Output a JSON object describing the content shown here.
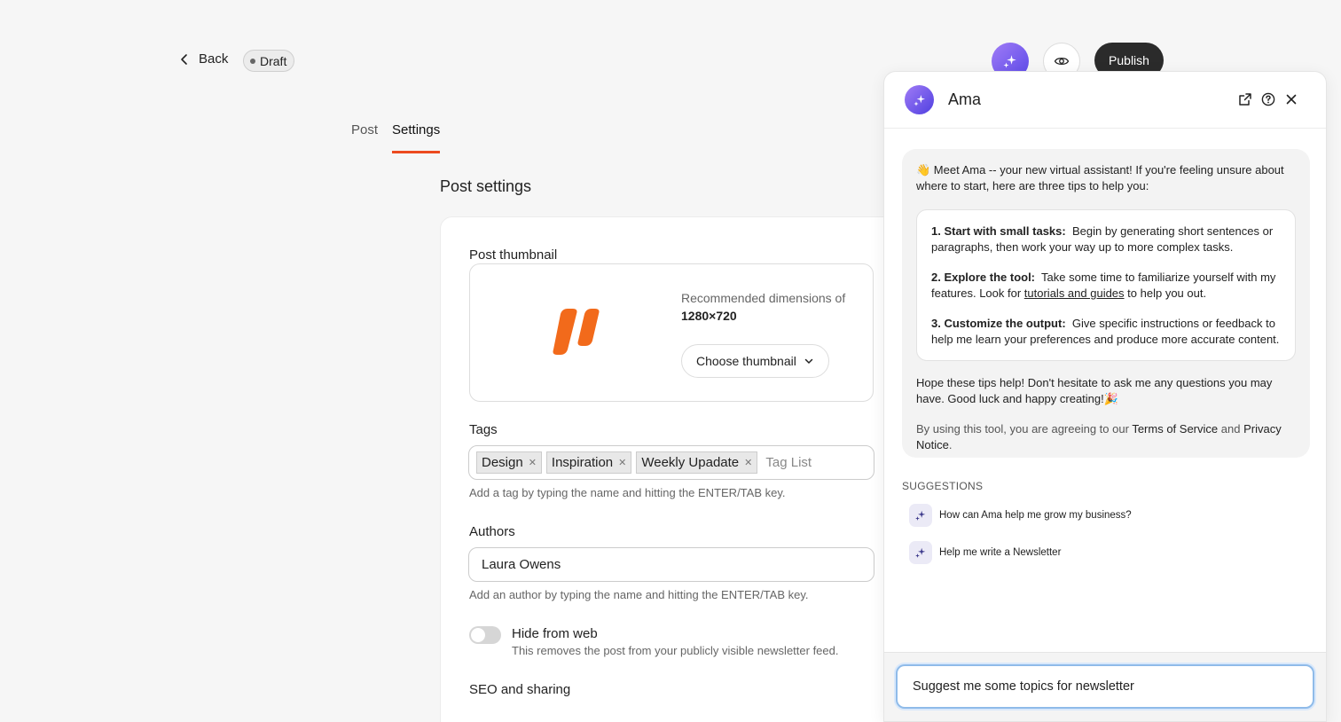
{
  "header": {
    "back_label": "Back",
    "status_badge": "Draft",
    "publish_label": "Publish"
  },
  "tabs": [
    {
      "label": "Post",
      "active": false
    },
    {
      "label": "Settings",
      "active": true
    }
  ],
  "page_title": "Post settings",
  "thumbnail": {
    "label": "Post thumbnail",
    "recommended_prefix": "Recommended dimensions of",
    "recommended_size": "1280×720",
    "choose_label": "Choose thumbnail"
  },
  "tags": {
    "label": "Tags",
    "items": [
      "Design",
      "Inspiration",
      "Weekly Upadate"
    ],
    "placeholder": "Tag List",
    "help": "Add a tag by typing the name and hitting the ENTER/TAB key."
  },
  "authors": {
    "label": "Authors",
    "value": "Laura Owens",
    "help": "Add an author by typing the name and hitting the ENTER/TAB key."
  },
  "hide_from_web": {
    "title": "Hide from web",
    "description": "This removes the post from your publicly visible newsletter feed.",
    "enabled": false
  },
  "seo_label": "SEO and sharing",
  "assistant": {
    "name": "Ama",
    "intro": "👋 Meet Ama -- your new virtual assistant! If you're feeling unsure about where to start, here are three tips to help you:",
    "tips": [
      {
        "title": "1. Start with small tasks:",
        "text": "Begin by generating short sentences or paragraphs, then work your way up to more complex tasks."
      },
      {
        "title": "2. Explore the tool:",
        "text_before": "Take some time to familiarize yourself with my features. Look for",
        "link": "tutorials and guides",
        "text_after": "to help you out."
      },
      {
        "title": "3. Customize the output:",
        "text": "Give specific instructions or feedback to help me learn your preferences and produce more accurate content."
      }
    ],
    "closing": "Hope these tips help! Don't hesitate to ask me any questions you may have. Good luck and happy creating!🎉",
    "terms_prefix": "By using this tool, you are agreeing to our",
    "terms_link": "Terms of Service",
    "terms_and": "and",
    "privacy_link": "Privacy Notice",
    "terms_suffix": ".",
    "suggestions_title": "SUGGESTIONS",
    "suggestions": [
      "How can Ama help me grow my business?",
      "Help me write a Newsletter"
    ],
    "input_value": "Suggest me some topics for newsletter"
  },
  "colors": {
    "accent": "#ec4a1f",
    "brand_orange": "#f26a1b",
    "assistant_purple": "#5a48e8",
    "publish_bg": "#2b2b2b"
  }
}
